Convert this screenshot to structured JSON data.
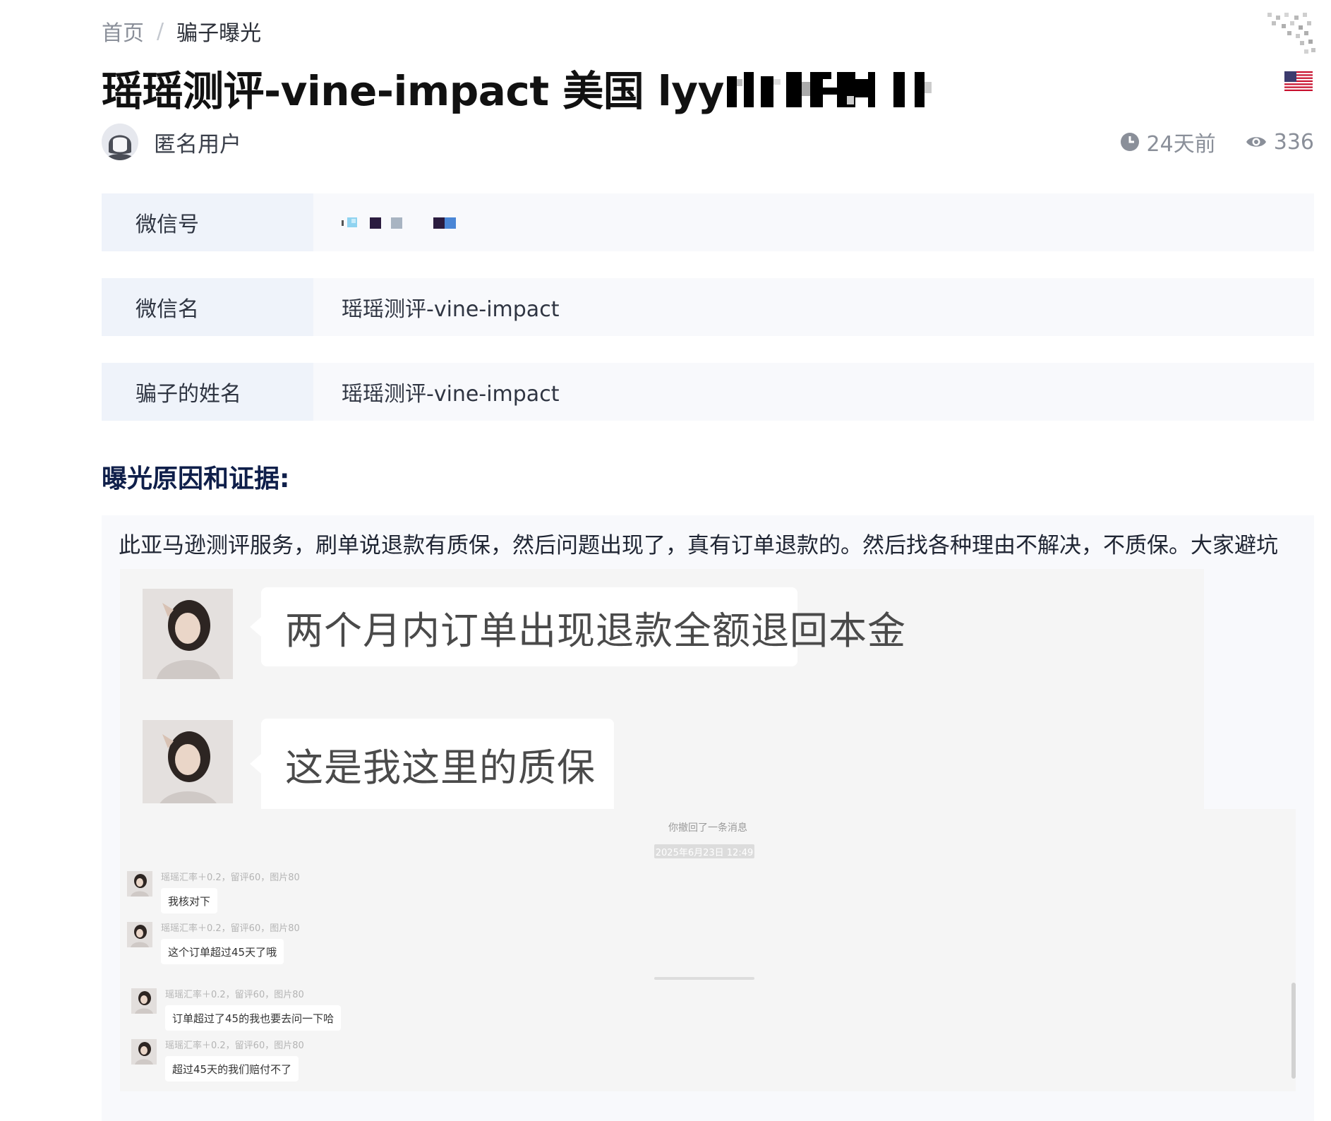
{
  "breadcrumb": {
    "home": "首页",
    "separator": "/",
    "current": "骗子曝光"
  },
  "title": {
    "text": "瑶瑶测评-vine-impact 美国 lyy",
    "country_flag": "us-flag-icon"
  },
  "author": {
    "name": "匿名用户"
  },
  "meta": {
    "time": "24天前",
    "views": "336"
  },
  "fields": [
    {
      "label": "微信号",
      "value": ""
    },
    {
      "label": "微信名",
      "value": "瑶瑶测评-vine-impact"
    },
    {
      "label": "骗子的姓名",
      "value": "瑶瑶测评-vine-impact"
    }
  ],
  "section_title": "曝光原因和证据:",
  "evidence": {
    "text": "此亚马逊测评服务，刷单说退款有质保，然后问题出现了，真有订单退款的。然后找各种理由不解决，不质保。大家避坑",
    "screenshot_top": {
      "messages": [
        "两个月内订单出现退款全额退回本金",
        "这是我这里的质保"
      ]
    },
    "screenshot_bottom": {
      "recall_note": "你撤回了一条消息",
      "timestamp": "2025年6月23日 12:49",
      "messages": [
        {
          "sender": "瑶瑶汇率＋0.2，留评60，图片80",
          "text": "我核对下"
        },
        {
          "sender": "瑶瑶汇率＋0.2，留评60，图片80",
          "text": "这个订单超过45天了哦"
        },
        {
          "sender": "瑶瑶汇率＋0.2，留评60，图片80",
          "text": "订单超过了45的我也要去问一下哈"
        },
        {
          "sender": "瑶瑶汇率＋0.2，留评60，图片80",
          "text": "超过45天的我们赔付不了"
        }
      ]
    }
  },
  "colors": {
    "section_title": "#0f1f4a",
    "label_bg": "#eff3fa",
    "value_bg": "#f8f9fc",
    "chat_bg": "#f5f5f5"
  }
}
